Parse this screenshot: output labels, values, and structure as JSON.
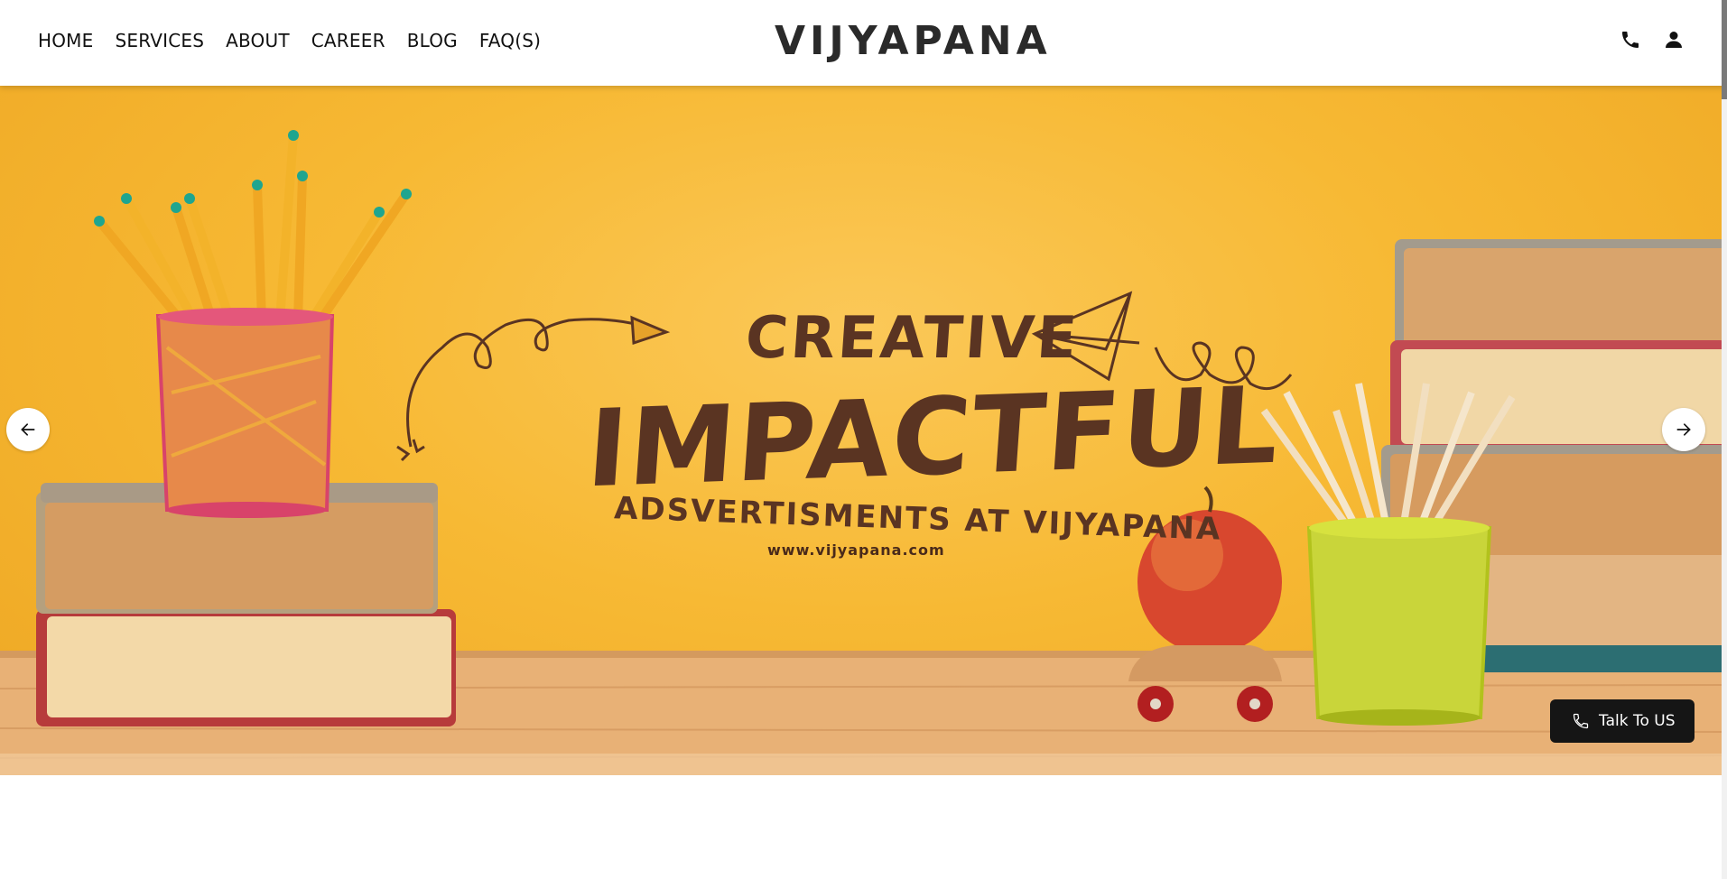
{
  "header": {
    "nav": [
      {
        "label": "HOME"
      },
      {
        "label": "SERVICES"
      },
      {
        "label": "ABOUT"
      },
      {
        "label": "CAREER"
      },
      {
        "label": "BLOG"
      },
      {
        "label": "FAQ(S)"
      }
    ],
    "brand": "VIJYAPANA",
    "icons": [
      "phone-icon",
      "user-icon"
    ]
  },
  "hero": {
    "line1": "CREATIVE",
    "line2": "IMPACTFUL",
    "line3": "ADSVERTISMENTS AT VIJYAPANA",
    "url": "www.vijyapana.com",
    "prev_icon": "arrow-left-icon",
    "next_icon": "arrow-right-icon"
  },
  "talk_button": {
    "label": "Talk To US",
    "icon": "phone-outline-icon"
  },
  "colors": {
    "hero_bg": "#f7b934",
    "headline": "#5a3422",
    "button_dark": "#151515"
  }
}
